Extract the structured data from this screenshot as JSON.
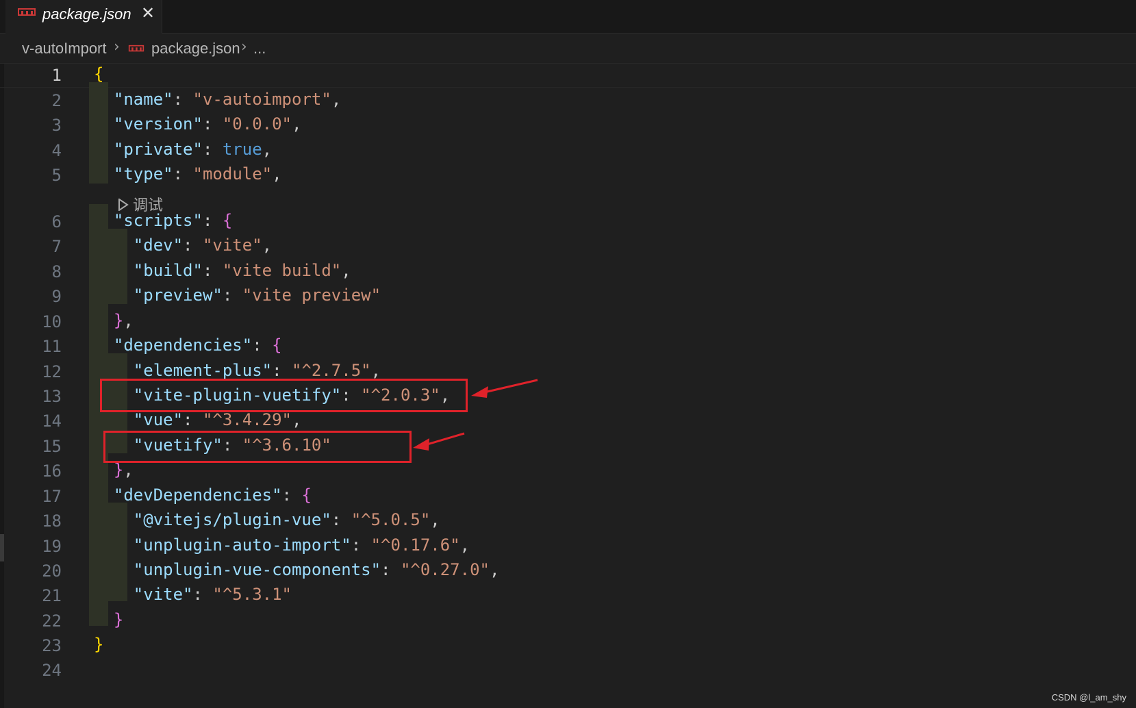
{
  "tab": {
    "filename": "package.json",
    "close_glyph": "✕",
    "icon": "npm-icon"
  },
  "breadcrumb": {
    "folder": "v-autoImport",
    "file": "package.json",
    "more": "..."
  },
  "codelens": {
    "label": "调试"
  },
  "lines": [
    {
      "n": "1",
      "tokens": [
        {
          "c": "p1",
          "t": "{"
        }
      ]
    },
    {
      "n": "2",
      "tokens": [
        {
          "c": "",
          "t": "  "
        },
        {
          "c": "k",
          "t": "\"name\""
        },
        {
          "c": "",
          "t": ": "
        },
        {
          "c": "s",
          "t": "\"v-autoimport\""
        },
        {
          "c": "",
          "t": ","
        }
      ]
    },
    {
      "n": "3",
      "tokens": [
        {
          "c": "",
          "t": "  "
        },
        {
          "c": "k",
          "t": "\"version\""
        },
        {
          "c": "",
          "t": ": "
        },
        {
          "c": "s",
          "t": "\"0.0.0\""
        },
        {
          "c": "",
          "t": ","
        }
      ]
    },
    {
      "n": "4",
      "tokens": [
        {
          "c": "",
          "t": "  "
        },
        {
          "c": "k",
          "t": "\"private\""
        },
        {
          "c": "",
          "t": ": "
        },
        {
          "c": "b",
          "t": "true"
        },
        {
          "c": "",
          "t": ","
        }
      ]
    },
    {
      "n": "5",
      "tokens": [
        {
          "c": "",
          "t": "  "
        },
        {
          "c": "k",
          "t": "\"type\""
        },
        {
          "c": "",
          "t": ": "
        },
        {
          "c": "s",
          "t": "\"module\""
        },
        {
          "c": "",
          "t": ","
        }
      ]
    },
    {
      "n": "6",
      "tokens": [
        {
          "c": "",
          "t": "  "
        },
        {
          "c": "k",
          "t": "\"scripts\""
        },
        {
          "c": "",
          "t": ": "
        },
        {
          "c": "p2",
          "t": "{"
        }
      ]
    },
    {
      "n": "7",
      "tokens": [
        {
          "c": "",
          "t": "    "
        },
        {
          "c": "k",
          "t": "\"dev\""
        },
        {
          "c": "",
          "t": ": "
        },
        {
          "c": "s",
          "t": "\"vite\""
        },
        {
          "c": "",
          "t": ","
        }
      ]
    },
    {
      "n": "8",
      "tokens": [
        {
          "c": "",
          "t": "    "
        },
        {
          "c": "k",
          "t": "\"build\""
        },
        {
          "c": "",
          "t": ": "
        },
        {
          "c": "s",
          "t": "\"vite build\""
        },
        {
          "c": "",
          "t": ","
        }
      ]
    },
    {
      "n": "9",
      "tokens": [
        {
          "c": "",
          "t": "    "
        },
        {
          "c": "k",
          "t": "\"preview\""
        },
        {
          "c": "",
          "t": ": "
        },
        {
          "c": "s",
          "t": "\"vite preview\""
        }
      ]
    },
    {
      "n": "10",
      "tokens": [
        {
          "c": "",
          "t": "  "
        },
        {
          "c": "p2",
          "t": "}"
        },
        {
          "c": "",
          "t": ","
        }
      ]
    },
    {
      "n": "11",
      "tokens": [
        {
          "c": "",
          "t": "  "
        },
        {
          "c": "k",
          "t": "\"dependencies\""
        },
        {
          "c": "",
          "t": ": "
        },
        {
          "c": "p2",
          "t": "{"
        }
      ]
    },
    {
      "n": "12",
      "tokens": [
        {
          "c": "",
          "t": "    "
        },
        {
          "c": "k",
          "t": "\"element-plus\""
        },
        {
          "c": "",
          "t": ": "
        },
        {
          "c": "s",
          "t": "\"^2.7.5\""
        },
        {
          "c": "",
          "t": ","
        }
      ]
    },
    {
      "n": "13",
      "tokens": [
        {
          "c": "",
          "t": "    "
        },
        {
          "c": "k",
          "t": "\"vite-plugin-vuetify\""
        },
        {
          "c": "",
          "t": ": "
        },
        {
          "c": "s",
          "t": "\"^2.0.3\""
        },
        {
          "c": "",
          "t": ","
        }
      ]
    },
    {
      "n": "14",
      "tokens": [
        {
          "c": "",
          "t": "    "
        },
        {
          "c": "k",
          "t": "\"vue\""
        },
        {
          "c": "",
          "t": ": "
        },
        {
          "c": "s",
          "t": "\"^3.4.29\""
        },
        {
          "c": "",
          "t": ","
        }
      ]
    },
    {
      "n": "15",
      "tokens": [
        {
          "c": "",
          "t": "    "
        },
        {
          "c": "k",
          "t": "\"vuetify\""
        },
        {
          "c": "",
          "t": ": "
        },
        {
          "c": "s",
          "t": "\"^3.6.10\""
        }
      ]
    },
    {
      "n": "16",
      "tokens": [
        {
          "c": "",
          "t": "  "
        },
        {
          "c": "p2",
          "t": "}"
        },
        {
          "c": "",
          "t": ","
        }
      ]
    },
    {
      "n": "17",
      "tokens": [
        {
          "c": "",
          "t": "  "
        },
        {
          "c": "k",
          "t": "\"devDependencies\""
        },
        {
          "c": "",
          "t": ": "
        },
        {
          "c": "p2",
          "t": "{"
        }
      ]
    },
    {
      "n": "18",
      "tokens": [
        {
          "c": "",
          "t": "    "
        },
        {
          "c": "k",
          "t": "\"@vitejs/plugin-vue\""
        },
        {
          "c": "",
          "t": ": "
        },
        {
          "c": "s",
          "t": "\"^5.0.5\""
        },
        {
          "c": "",
          "t": ","
        }
      ]
    },
    {
      "n": "19",
      "tokens": [
        {
          "c": "",
          "t": "    "
        },
        {
          "c": "k",
          "t": "\"unplugin-auto-import\""
        },
        {
          "c": "",
          "t": ": "
        },
        {
          "c": "s",
          "t": "\"^0.17.6\""
        },
        {
          "c": "",
          "t": ","
        }
      ]
    },
    {
      "n": "20",
      "tokens": [
        {
          "c": "",
          "t": "    "
        },
        {
          "c": "k",
          "t": "\"unplugin-vue-components\""
        },
        {
          "c": "",
          "t": ": "
        },
        {
          "c": "s",
          "t": "\"^0.27.0\""
        },
        {
          "c": "",
          "t": ","
        }
      ]
    },
    {
      "n": "21",
      "tokens": [
        {
          "c": "",
          "t": "    "
        },
        {
          "c": "k",
          "t": "\"vite\""
        },
        {
          "c": "",
          "t": ": "
        },
        {
          "c": "s",
          "t": "\"^5.3.1\""
        }
      ]
    },
    {
      "n": "22",
      "tokens": [
        {
          "c": "",
          "t": "  "
        },
        {
          "c": "p2",
          "t": "}"
        }
      ]
    },
    {
      "n": "23",
      "tokens": [
        {
          "c": "p1",
          "t": "}"
        }
      ]
    },
    {
      "n": "24",
      "tokens": []
    }
  ],
  "watermark": "CSDN @l_am_shy",
  "colors": {
    "annotation": "#e0222a",
    "key": "#9cdcfe",
    "string": "#ce9178",
    "boolean": "#569cd6",
    "bracket1": "#ffd700",
    "bracket2": "#da70d6"
  }
}
